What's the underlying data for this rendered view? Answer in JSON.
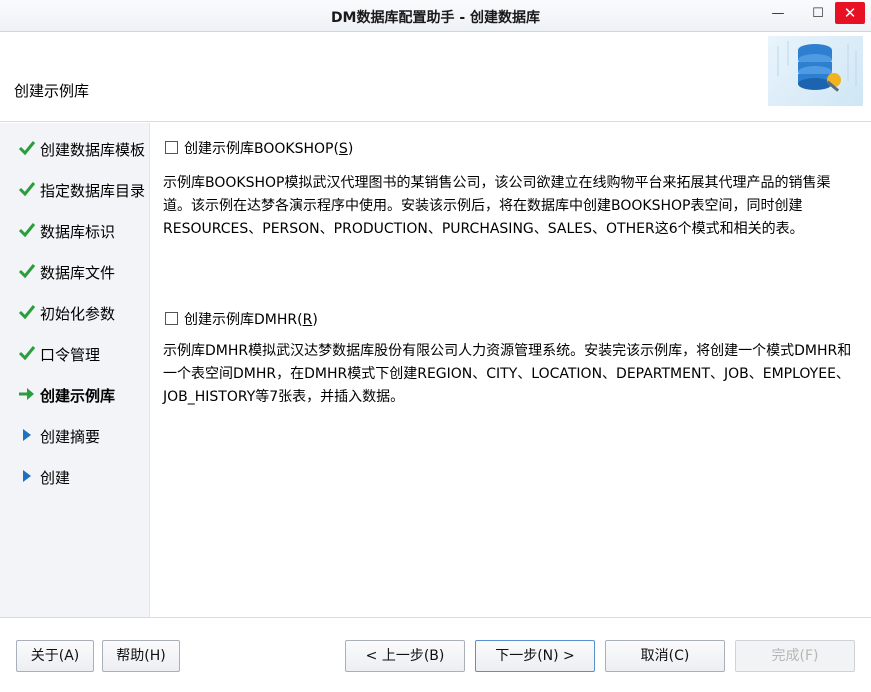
{
  "window": {
    "title": "DM数据库配置助手 - 创建数据库",
    "min_glyph": "—",
    "max_glyph": "☐",
    "close_glyph": "✕"
  },
  "header": {
    "section_title": "创建示例库"
  },
  "steps": [
    {
      "label": "创建数据库模板",
      "status": "done"
    },
    {
      "label": "指定数据库目录",
      "status": "done"
    },
    {
      "label": "数据库标识",
      "status": "done"
    },
    {
      "label": "数据库文件",
      "status": "done"
    },
    {
      "label": "初始化参数",
      "status": "done"
    },
    {
      "label": "口令管理",
      "status": "done"
    },
    {
      "label": "创建示例库",
      "status": "current"
    },
    {
      "label": "创建摘要",
      "status": "pending"
    },
    {
      "label": "创建",
      "status": "pending"
    }
  ],
  "options": {
    "bookshop": {
      "label_prefix": "创建示例库BOOKSHOP(",
      "mnemonic": "S",
      "label_suffix": ")",
      "checked": false,
      "description": "示例库BOOKSHOP模拟武汉代理图书的某销售公司，该公司欲建立在线购物平台来拓展其代理产品的销售渠道。该示例在达梦各演示程序中使用。安装该示例后，将在数据库中创建BOOKSHOP表空间，同时创建RESOURCES、PERSON、PRODUCTION、PURCHASING、SALES、OTHER这6个模式和相关的表。"
    },
    "dmhr": {
      "label_prefix": "创建示例库DMHR(",
      "mnemonic": "R",
      "label_suffix": ")",
      "checked": false,
      "description": "示例库DMHR模拟武汉达梦数据库股份有限公司人力资源管理系统。安装完该示例库，将创建一个模式DMHR和一个表空间DMHR，在DMHR模式下创建REGION、CITY、LOCATION、DEPARTMENT、JOB、EMPLOYEE、JOB_HISTORY等7张表，并插入数据。"
    }
  },
  "buttons": {
    "about": "关于(A)",
    "help": "帮助(H)",
    "back": "< 上一步(B)",
    "next": "下一步(N) >",
    "cancel": "取消(C)",
    "finish": "完成(F)"
  },
  "colors": {
    "check": "#2a9d3c",
    "current_arrow": "#2a9d3c",
    "pending_arrow": "#1f6fc2",
    "close_button": "#e81123"
  }
}
